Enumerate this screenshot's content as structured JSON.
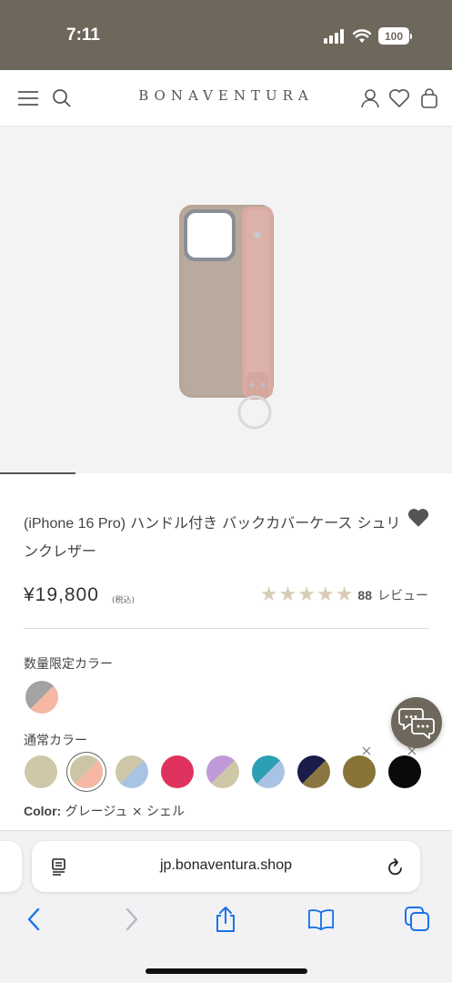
{
  "status_bar": {
    "time": "7:11",
    "battery": "100"
  },
  "header": {
    "logo": "BONAVENTURA",
    "icons": [
      "menu-icon",
      "search-icon",
      "account-icon",
      "heart-icon",
      "bag-icon"
    ]
  },
  "product": {
    "title_en": "(iPhone 16 Pro)",
    "title_rest": " ハンドル付き バックカバーケース シュリンクレザー",
    "price": "¥19,800",
    "tax_note": "(税込)",
    "rating_stars": 5,
    "review_count": "88",
    "review_label": "レビュー"
  },
  "colors": {
    "limited_label": "数量限定カラー",
    "limited": [
      {
        "name": "limited-gray-shell",
        "c1": "#a3a3a3",
        "c2": "#f4b8a4"
      }
    ],
    "regular_label": "通常カラー",
    "regular": [
      {
        "name": "swatch-beige",
        "c1": "#cfc8a8",
        "c2": "#cfc8a8",
        "soldout": false
      },
      {
        "name": "swatch-greige-shell",
        "c1": "#cdc6a6",
        "c2": "#f4b8a4",
        "soldout": false,
        "selected": true
      },
      {
        "name": "swatch-beige-blue",
        "c1": "#cfc8a8",
        "c2": "#a9c3e4",
        "soldout": false
      },
      {
        "name": "swatch-pink",
        "c1": "#e0325e",
        "c2": "#e0325e",
        "soldout": false
      },
      {
        "name": "swatch-lavender-beige",
        "c1": "#c09ad8",
        "c2": "#cfc8a8",
        "soldout": false
      },
      {
        "name": "swatch-teal-blue",
        "c1": "#2c9fb3",
        "c2": "#a9c3e4",
        "soldout": false
      },
      {
        "name": "swatch-navy-olive",
        "c1": "#1c1c4a",
        "c2": "#8a7640",
        "soldout": false
      },
      {
        "name": "swatch-olive",
        "c1": "#877436",
        "c2": "#877436",
        "soldout": true
      },
      {
        "name": "swatch-black",
        "c1": "#0a0a0a",
        "c2": "#0a0a0a",
        "soldout": true
      }
    ],
    "selected_prefix": "Color:",
    "selected_value": " グレージュ × シェル"
  },
  "browser": {
    "url": "jp.bonaventura.shop"
  },
  "theme": {
    "status_bg": "#6e675c",
    "star_color": "#d8cdb4",
    "ios_blue": "#1a73e8"
  }
}
